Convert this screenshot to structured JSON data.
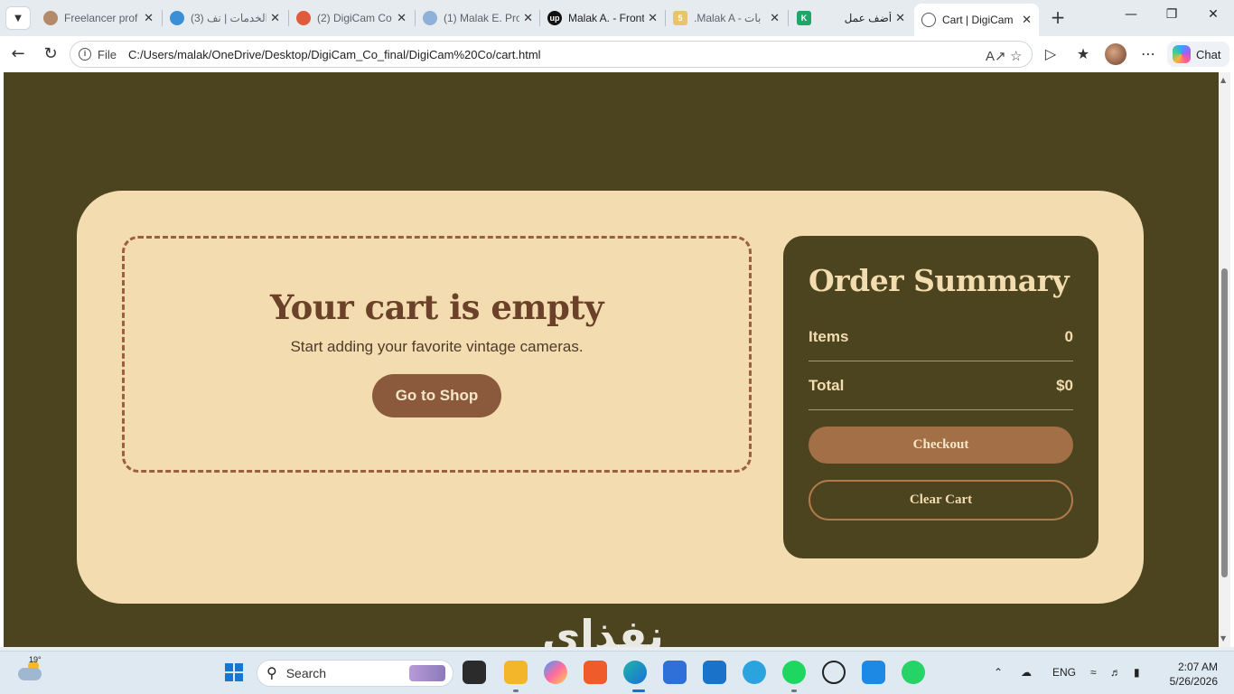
{
  "browser": {
    "tabs": [
      {
        "title": "Freelancer prof",
        "favicon_color": "#b38a6a"
      },
      {
        "title": "(3) الخدمات | نف",
        "favicon_color": "#3a8fd8"
      },
      {
        "title": "(2) DigiCam Co",
        "favicon_color": "#e05a3c"
      },
      {
        "title": "(1) Malak E. Pro",
        "favicon_color": "#8fb0d8"
      },
      {
        "title": "Malak A. - Front",
        "favicon_color": "#111111"
      },
      {
        "title": ".Malak A - بات",
        "favicon_color": "#e8c46a"
      },
      {
        "title": "",
        "favicon_color": "#1fa567"
      },
      {
        "title": "أضف عمل",
        "favicon_color": "#e6ebf0"
      },
      {
        "title": "Cart | DigiCam",
        "favicon_color": "#555555"
      }
    ],
    "address": {
      "scheme_label": "File",
      "url": "C:/Users/malak/OneDrive/Desktop/DigiCam_Co_final/DigiCam%20Co/cart.html"
    },
    "copilot_label": "Chat"
  },
  "page": {
    "empty_cart": {
      "title": "Your cart is empty",
      "subtitle": "Start adding your favorite vintage cameras.",
      "shop_button": "Go to Shop"
    },
    "summary": {
      "title": "Order Summary",
      "items_label": "Items",
      "items_value": "0",
      "total_label": "Total",
      "total_value": "$0",
      "checkout_button": "Checkout",
      "clear_button": "Clear Cart"
    },
    "watermark": "نفذاي"
  },
  "taskbar": {
    "weather_temp": "19°",
    "search_placeholder": "Search",
    "language": "ENG",
    "time": "2:07 AM",
    "date": "5/26/2026"
  },
  "colors": {
    "page_bg": "#4b441e",
    "card_bg": "#f3dcb0",
    "accent_brown": "#8b5a3c",
    "checkout": "#a36f46"
  }
}
